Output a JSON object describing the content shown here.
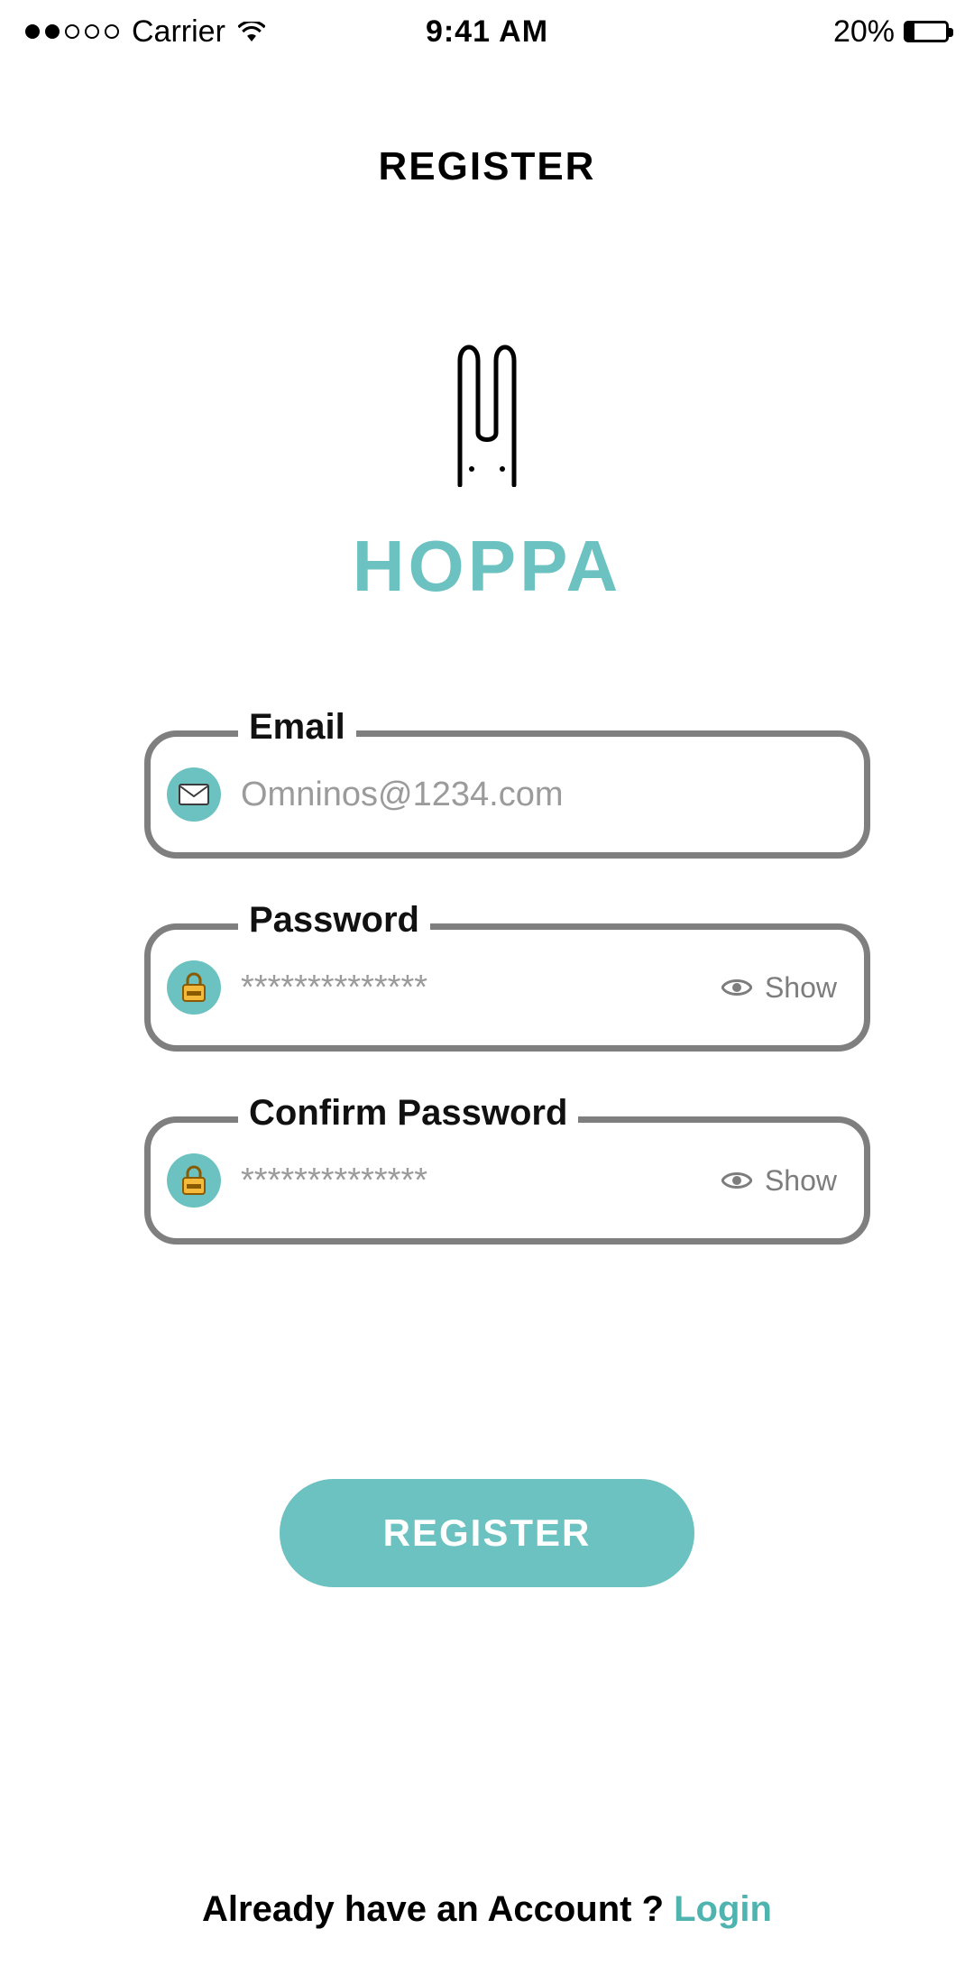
{
  "status_bar": {
    "carrier": "Carrier",
    "time": "9:41 AM",
    "battery_pct": "20%"
  },
  "page": {
    "title": "REGISTER"
  },
  "brand": {
    "name": "HOPPA"
  },
  "form": {
    "email": {
      "label": "Email",
      "placeholder": "Omninos@1234.com",
      "value": ""
    },
    "password": {
      "label": "Password",
      "placeholder": "**************",
      "value": "",
      "toggle": "Show"
    },
    "confirm": {
      "label": "Confirm Password",
      "placeholder": "**************",
      "value": "",
      "toggle": "Show"
    }
  },
  "actions": {
    "register": "REGISTER"
  },
  "footer": {
    "prompt": "Already have an Account ? ",
    "login": "Login"
  },
  "colors": {
    "accent": "#6bc2c1",
    "border": "#7f7f7f"
  }
}
